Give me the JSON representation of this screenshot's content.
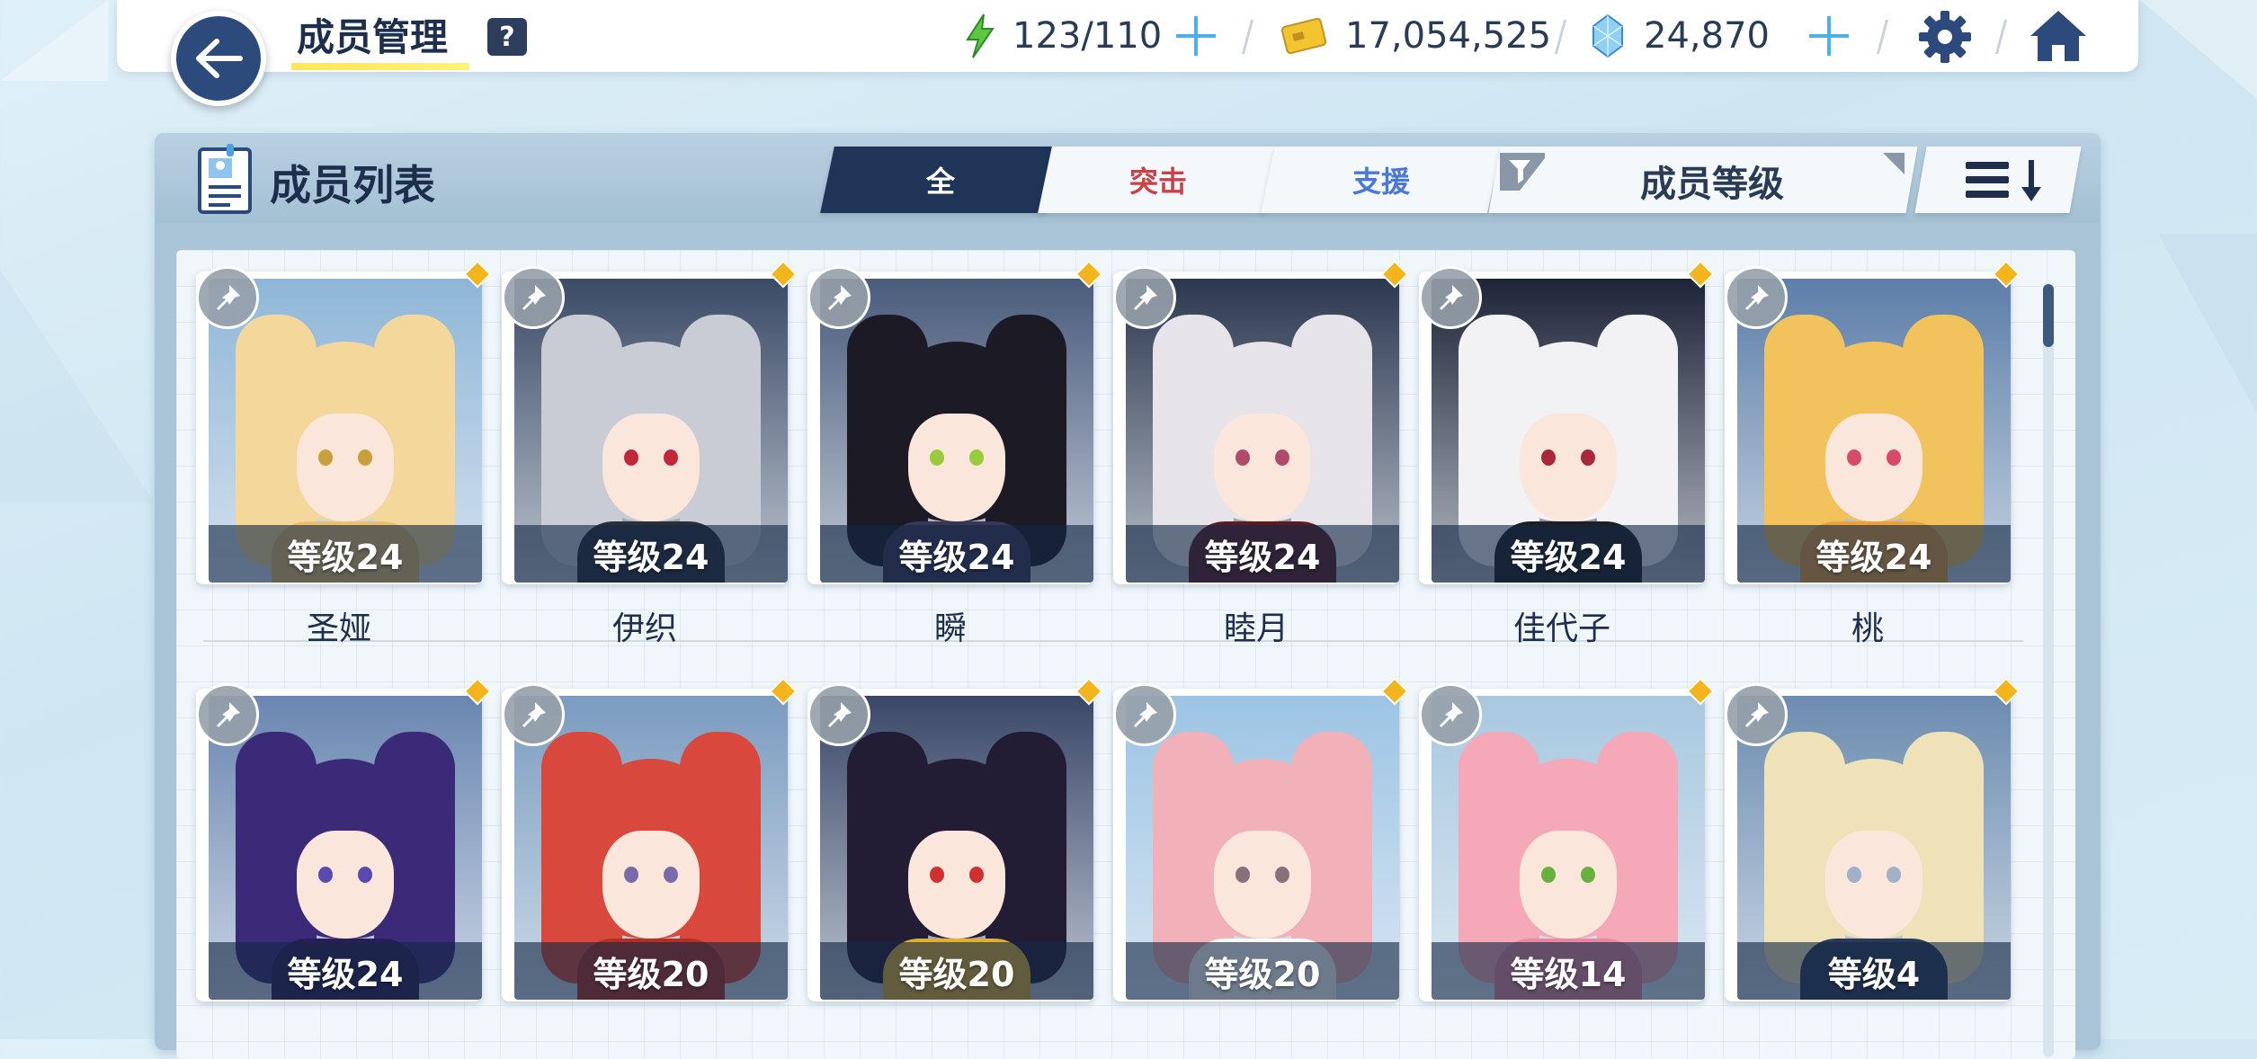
{
  "header": {
    "title": "成员管理",
    "help": "?",
    "ap": "123/110",
    "credits": "17,054,525",
    "pyroxene": "24,870"
  },
  "panel": {
    "title": "成员列表",
    "tabs": [
      {
        "label": "全",
        "active": true,
        "color": "#ffffff"
      },
      {
        "label": "突击",
        "active": false,
        "color": "#c8424a"
      },
      {
        "label": "支援",
        "active": false,
        "color": "#4a78d8"
      }
    ],
    "sort_label": "成员等级"
  },
  "members": [
    {
      "name": "圣娅",
      "level": "等级24",
      "hair": "#f4d79a",
      "accent": "#e8c070",
      "eye": "#c9a03c",
      "bg": "#8fb6d8"
    },
    {
      "name": "伊织",
      "level": "等级24",
      "hair": "#c9ccd4",
      "accent": "#2b2f3a",
      "eye": "#c0283a",
      "bg": "#3b4b66"
    },
    {
      "name": "瞬",
      "level": "等级24",
      "hair": "#1c1a24",
      "accent": "#3a3658",
      "eye": "#9acb3c",
      "bg": "#4a5c7c"
    },
    {
      "name": "睦月",
      "level": "等级24",
      "hair": "#e6e4e8",
      "accent": "#5a1c24",
      "eye": "#b04a6a",
      "bg": "#2c3850"
    },
    {
      "name": "佳代子",
      "level": "等级24",
      "hair": "#f2f2f4",
      "accent": "#1e1e24",
      "eye": "#a8283a",
      "bg": "#1e2438"
    },
    {
      "name": "桃",
      "level": "等级24",
      "hair": "#f2c25c",
      "accent": "#e8a040",
      "eye": "#d84a6a",
      "bg": "#5c7ea8"
    },
    {
      "name": "",
      "level": "等级24",
      "hair": "#3a2a78",
      "accent": "#2a1e58",
      "eye": "#5a4ab0",
      "bg": "#6a86b0"
    },
    {
      "name": "",
      "level": "等级20",
      "hair": "#d8483c",
      "accent": "#b03028",
      "eye": "#7a6aa8",
      "bg": "#7a9cc0"
    },
    {
      "name": "",
      "level": "等级20",
      "hair": "#221c34",
      "accent": "#e0b030",
      "eye": "#d03030",
      "bg": "#3a4868"
    },
    {
      "name": "",
      "level": "等级20",
      "hair": "#f2b0b8",
      "accent": "#ffffff",
      "eye": "#8a7078",
      "bg": "#9cc4e4"
    },
    {
      "name": "",
      "level": "等级14",
      "hair": "#f4a8b8",
      "accent": "#e888a0",
      "eye": "#6ab040",
      "bg": "#a8c8e0"
    },
    {
      "name": "",
      "level": "等级4",
      "hair": "#f0e2b8",
      "accent": "#2c3a58",
      "eye": "#a0b0c8",
      "bg": "#6c8cb0"
    }
  ]
}
